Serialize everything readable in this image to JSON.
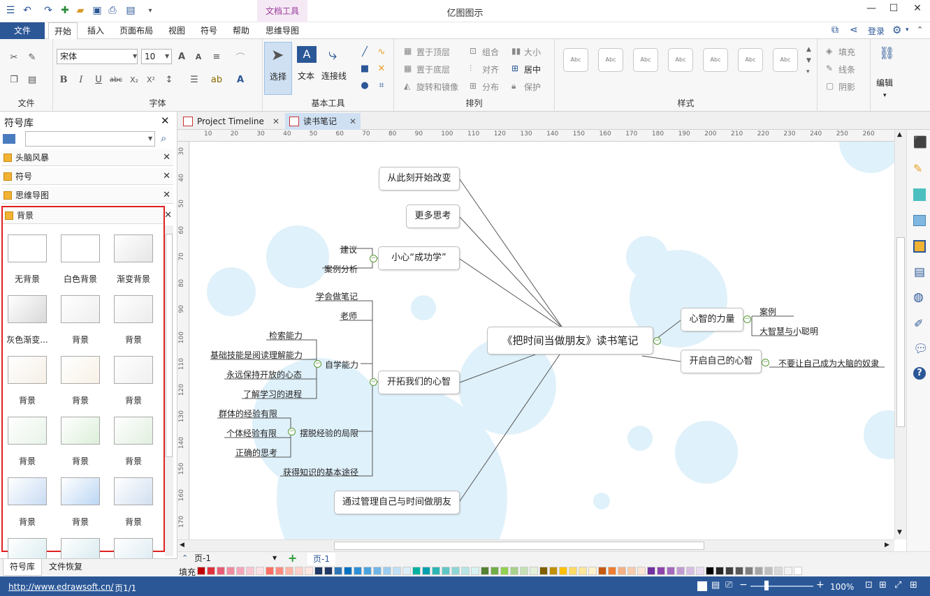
{
  "app": {
    "title": "亿图图示",
    "context_tab": "文档工具"
  },
  "ribbon_tabs": [
    "文件",
    "开始",
    "插入",
    "页面布局",
    "视图",
    "符号",
    "帮助",
    "思维导图"
  ],
  "account": {
    "login": "登录"
  },
  "font": {
    "name": "宋体",
    "size": "10"
  },
  "groups": {
    "file": "文件",
    "font": "字体",
    "basic_tools": "基本工具",
    "arrange": "排列",
    "style": "样式"
  },
  "tools": {
    "select": "选择",
    "text": "文本",
    "connector": "连接线",
    "edit": "编辑"
  },
  "arrange": {
    "bring_front": "置于顶层",
    "send_back": "置于底层",
    "rotate": "旋转和镜像",
    "group": "组合",
    "align": "对齐",
    "distribute": "分布",
    "size": "大小",
    "center": "居中",
    "protect": "保护"
  },
  "fill_group": {
    "fill": "填充",
    "line": "线条",
    "shadow": "阴影"
  },
  "style_sample": "Abc",
  "library": {
    "title": "符号库",
    "sections": [
      "头脑风暴",
      "符号",
      "思维导图",
      "背景"
    ],
    "thumbs": [
      {
        "label": "无背景",
        "color": "#ffffff"
      },
      {
        "label": "白色背景",
        "color": "#ffffff"
      },
      {
        "label": "渐变背景",
        "color": "#e6e6e6"
      },
      {
        "label": "灰色渐变...",
        "color": "#d9d9d9"
      },
      {
        "label": "背景",
        "color": "#eeeeee"
      },
      {
        "label": "背景",
        "color": "#ececec"
      },
      {
        "label": "背景",
        "color": "#f5efe6"
      },
      {
        "label": "背景",
        "color": "#f8f1e6"
      },
      {
        "label": "背景",
        "color": "#efefef"
      },
      {
        "label": "背景",
        "color": "#e8f3e8"
      },
      {
        "label": "背景",
        "color": "#dcefd9"
      },
      {
        "label": "背景",
        "color": "#e1efdf"
      },
      {
        "label": "背景",
        "color": "#c9dcf3"
      },
      {
        "label": "背景",
        "color": "#bcd6f3"
      },
      {
        "label": "背景",
        "color": "#d2dff0"
      },
      {
        "label": "",
        "color": "#d9ecef"
      },
      {
        "label": "",
        "color": "#d5e9ee"
      },
      {
        "label": "",
        "color": "#dbeaf2"
      }
    ]
  },
  "bottom_tabs": [
    "符号库",
    "文件恢复"
  ],
  "doc_tabs": [
    "Project Timeline",
    "读书笔记"
  ],
  "ruler": {
    "h": [
      "10",
      "20",
      "30",
      "40",
      "50",
      "60",
      "70",
      "80",
      "90",
      "100",
      "110",
      "120",
      "130",
      "140",
      "150",
      "160",
      "170",
      "180",
      "190",
      "200",
      "210",
      "220",
      "230",
      "240",
      "250",
      "260"
    ],
    "v": [
      "30",
      "40",
      "50",
      "60",
      "70",
      "80",
      "90",
      "100",
      "110",
      "120",
      "130",
      "140",
      "150",
      "160",
      "170"
    ]
  },
  "mindmap": {
    "center": "《把时间当做朋友》读书笔记",
    "nodes": {
      "n1": "从此刻开始改变",
      "n2": "更多思考",
      "n3": "小心“成功学”",
      "n4": "开拓我们的心智",
      "n5": "通过管理自己与时间做朋友",
      "n6": "心智的力量",
      "n7": "开启自己的心智"
    },
    "leaves": {
      "l_jianyi": "建议",
      "l_anli": "案例分析",
      "l_biji": "学会做笔记",
      "l_laoshi": "老师",
      "l_jiansuo": "检索能力",
      "l_jichu": "基础技能是阅读理解能力",
      "l_kaifang": "永远保持开放的心态",
      "l_jincheng": "了解学习的进程",
      "l_zixue": "自学能力",
      "l_qunti": "群体的经验有限",
      "l_geti": "个体经验有限",
      "l_baituo": "摆脱经验的局限",
      "l_zhengque": "正确的思考",
      "l_tujing": "获得知识的基本途径",
      "l_anli2": "案例",
      "l_dazhihui": "大智慧与小聪明",
      "l_nuli": "不要让自己成为大脑的奴隶"
    }
  },
  "page": {
    "selector": "页-1",
    "tab": "页-1"
  },
  "fill_label": "填充",
  "palette": [
    "#c00000",
    "#e0303c",
    "#e85d75",
    "#f08ca0",
    "#f4a6b8",
    "#f8c6d2",
    "#fbe0e6",
    "#ff6f61",
    "#ff8a80",
    "#ffb3a7",
    "#ffd1c8",
    "#ffe6e0",
    "#1f3864",
    "#203864",
    "#2e75b6",
    "#0070c0",
    "#2f8fd6",
    "#4aa3df",
    "#6fb6e8",
    "#9ccbf0",
    "#bfdff5",
    "#dbeefa",
    "#00b0a0",
    "#00a0b0",
    "#2cb5b5",
    "#5fc6c6",
    "#8ed6d6",
    "#b5e5e5",
    "#d6f2f2",
    "#548235",
    "#70ad47",
    "#92d050",
    "#a9d18e",
    "#c5e0b4",
    "#e2f0d9",
    "#7f6000",
    "#bf9000",
    "#ffc000",
    "#ffd966",
    "#ffe699",
    "#fff2cc",
    "#c55a11",
    "#ed7d31",
    "#f4b183",
    "#f8cbad",
    "#fbe5d6",
    "#7030a0",
    "#8e44ad",
    "#a569bd",
    "#c39bd3",
    "#d7bde2",
    "#e8daef",
    "#000000",
    "#262626",
    "#404040",
    "#595959",
    "#7f7f7f",
    "#a6a6a6",
    "#bfbfbf",
    "#d9d9d9",
    "#f2f2f2",
    "#ffffff"
  ],
  "status": {
    "url": "http://www.edrawsoft.cn/",
    "page": "页1/1",
    "zoom": "100%"
  }
}
